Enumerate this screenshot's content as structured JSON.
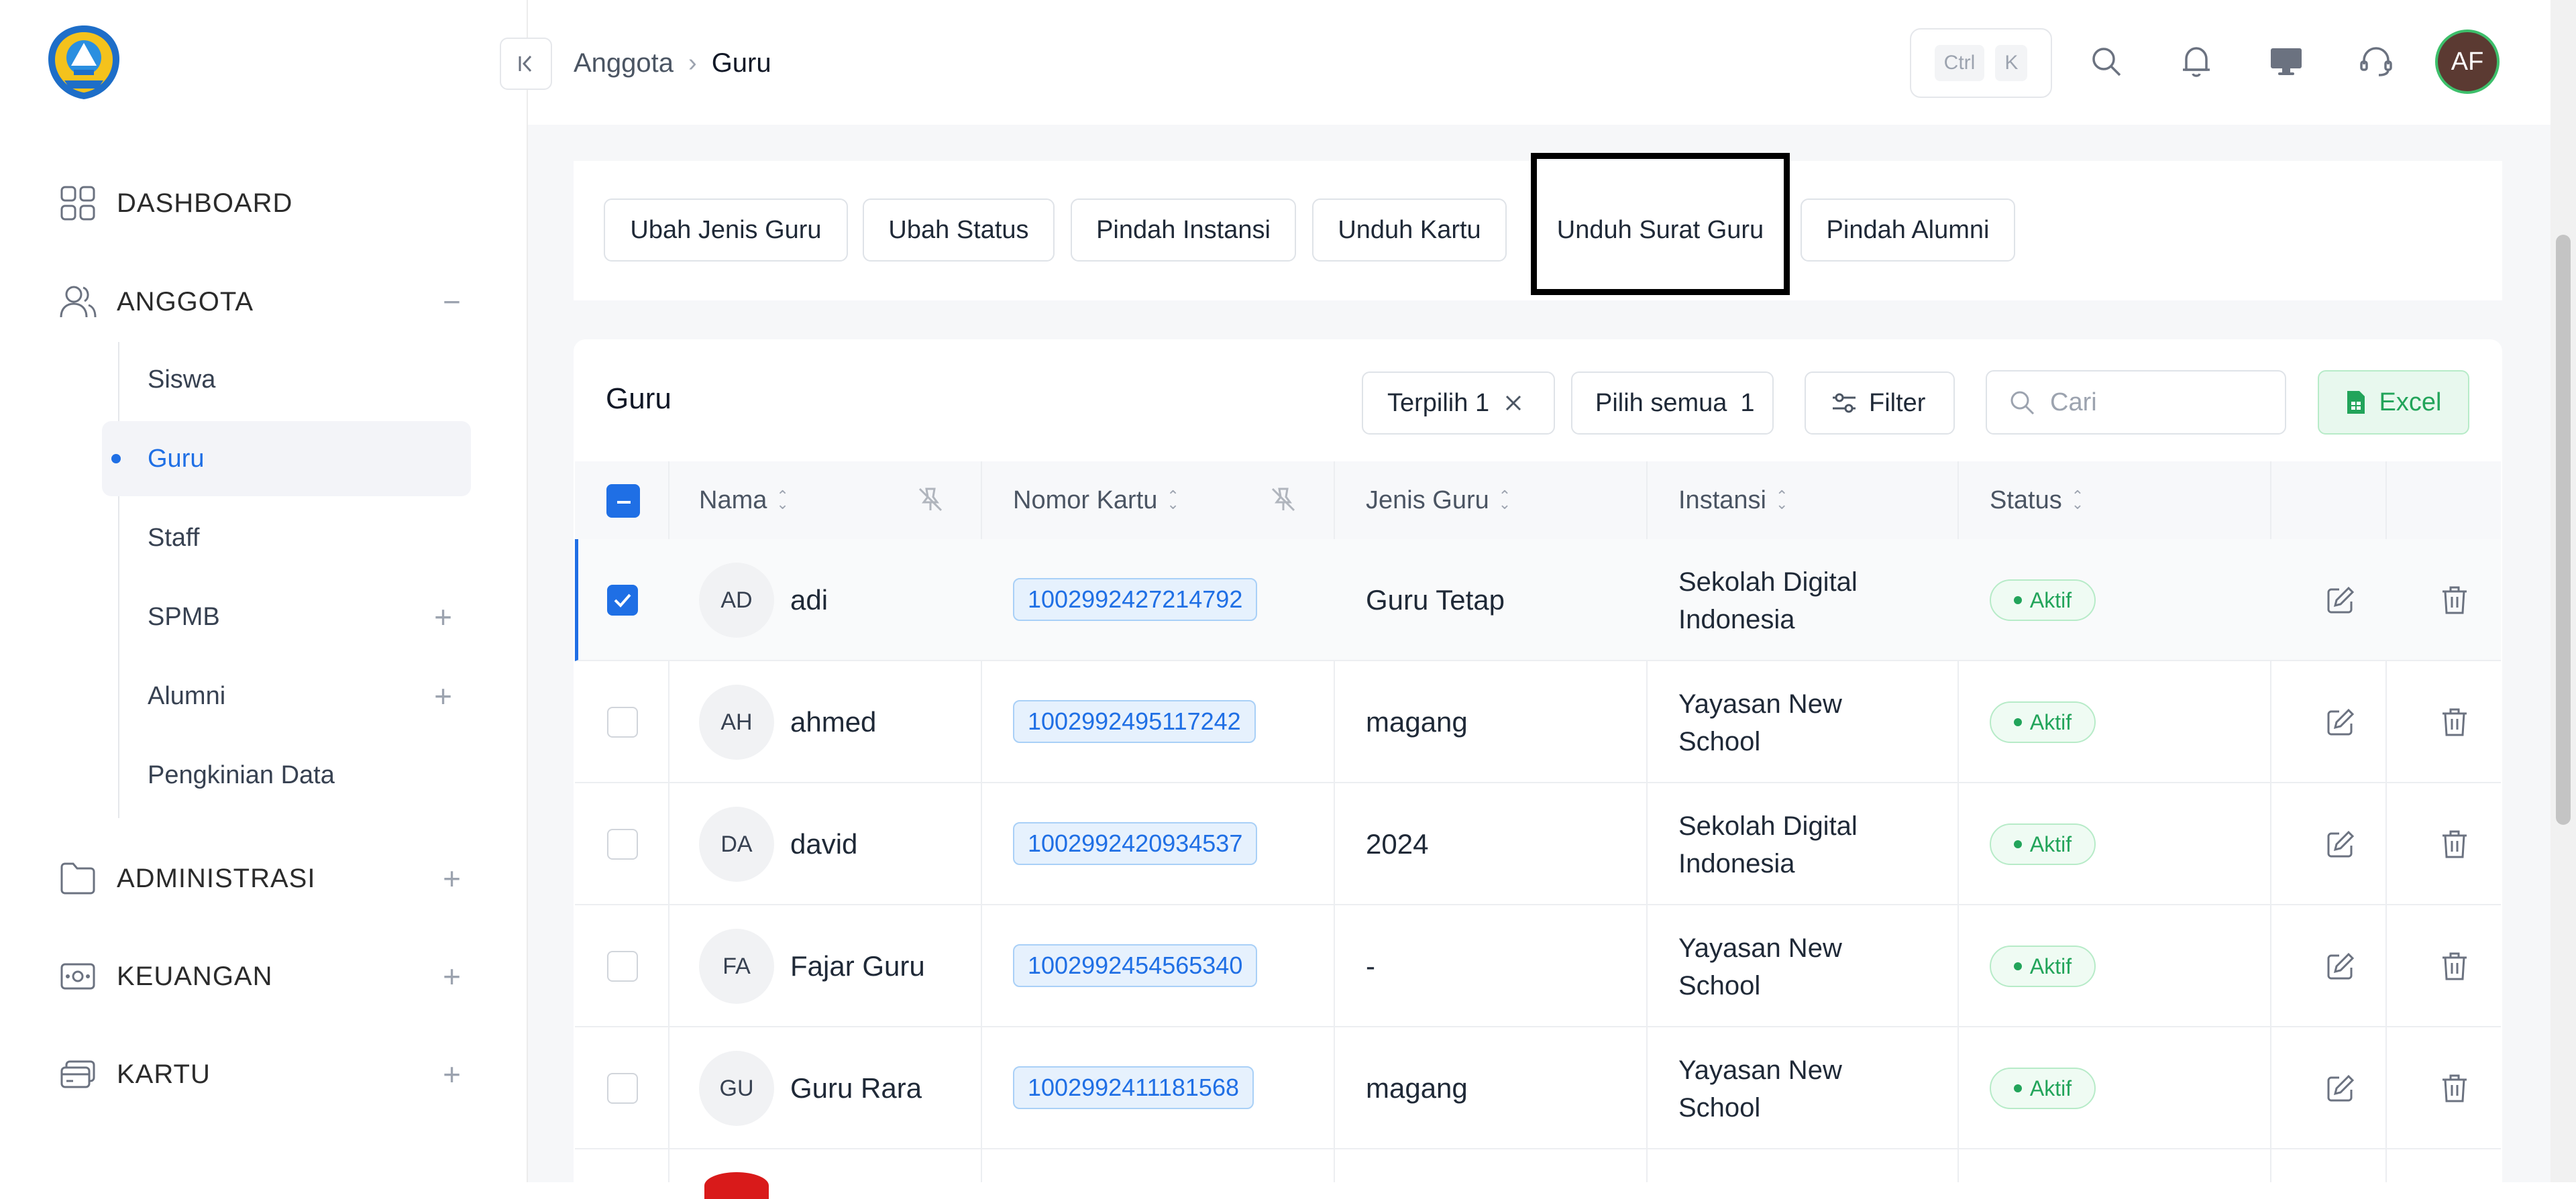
{
  "sidebar": {
    "nav": [
      {
        "label": "DASHBOARD",
        "icon": "grid-icon"
      },
      {
        "label": "ANGGOTA",
        "icon": "users-icon",
        "toggle": "−"
      },
      {
        "label": "ADMINISTRASI",
        "icon": "folder-icon",
        "toggle": "+"
      },
      {
        "label": "KEUANGAN",
        "icon": "money-icon",
        "toggle": "+"
      },
      {
        "label": "KARTU",
        "icon": "card-icon",
        "toggle": "+"
      }
    ],
    "sub": [
      {
        "label": "Siswa"
      },
      {
        "label": "Guru",
        "active": true
      },
      {
        "label": "Staff"
      },
      {
        "label": "SPMB",
        "toggle": "+"
      },
      {
        "label": "Alumni",
        "toggle": "+"
      },
      {
        "label": "Pengkinian Data"
      }
    ]
  },
  "header": {
    "breadcrumb": [
      "Anggota",
      "Guru"
    ],
    "shortcut": [
      "Ctrl",
      "K"
    ],
    "avatar": "AF"
  },
  "actions": [
    "Ubah Jenis Guru",
    "Ubah Status",
    "Pindah Instansi",
    "Unduh Kartu",
    "Unduh Surat Guru",
    "Pindah Alumni"
  ],
  "table": {
    "title": "Guru",
    "selected_label": "Terpilih 1",
    "select_all_label": "Pilih semua",
    "select_all_count": "1",
    "filter_label": "Filter",
    "search_placeholder": "Cari",
    "excel_label": "Excel",
    "columns": [
      "Nama",
      "Nomor Kartu",
      "Jenis Guru",
      "Instansi",
      "Status"
    ],
    "rows": [
      {
        "initials": "AD",
        "name": "adi",
        "card": "1002992427214792",
        "type": "Guru Tetap",
        "inst1": "Sekolah Digital",
        "inst2": "Indonesia",
        "status": "Aktif",
        "checked": true
      },
      {
        "initials": "AH",
        "name": "ahmed",
        "card": "1002992495117242",
        "type": "magang",
        "inst1": "Yayasan New",
        "inst2": "School",
        "status": "Aktif",
        "checked": false
      },
      {
        "initials": "DA",
        "name": "david",
        "card": "1002992420934537",
        "type": "2024",
        "inst1": "Sekolah Digital",
        "inst2": "Indonesia",
        "status": "Aktif",
        "checked": false
      },
      {
        "initials": "FA",
        "name": "Fajar Guru",
        "card": "1002992454565340",
        "type": "-",
        "inst1": "Yayasan New",
        "inst2": "School",
        "status": "Aktif",
        "checked": false
      },
      {
        "initials": "GU",
        "name": "Guru Rara",
        "card": "1002992411181568",
        "type": "magang",
        "inst1": "Yayasan New",
        "inst2": "School",
        "status": "Aktif",
        "checked": false
      }
    ]
  },
  "colors": {
    "accent": "#1f6fe5",
    "success": "#22a45a"
  }
}
